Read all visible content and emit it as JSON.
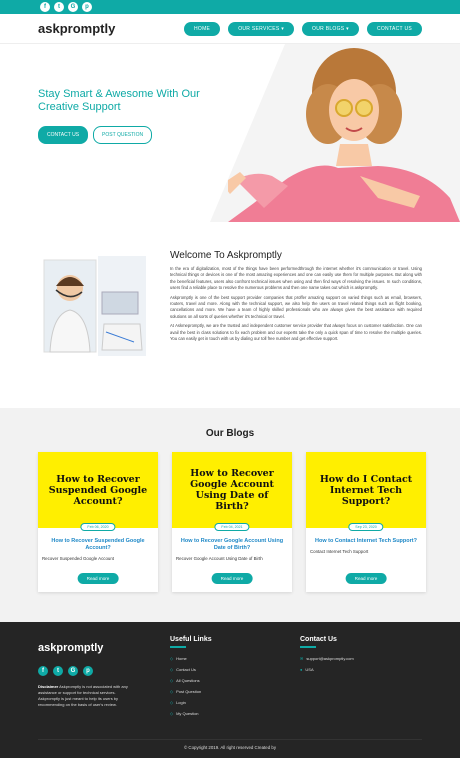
{
  "topbar": {
    "social": [
      "f",
      "t",
      "G",
      "p"
    ]
  },
  "logo": {
    "part1": "ask",
    "part2": "promptly"
  },
  "nav": {
    "home": "HOME",
    "services": "OUR SERVICES",
    "blogs": "OUR BLOGS",
    "contact": "CONTACT US"
  },
  "hero": {
    "title": "Stay Smart & Awesome With Our Creative Support",
    "btn_contact": "CONTACT US",
    "btn_post": "POST QUESTION"
  },
  "welcome": {
    "title": "Welcome To Askpromptly",
    "p1": "In the era of digitalization, most of the things have been performedthrough the internet whether it's communication or travel. Using technical things or devices is one of the most amazing experiences and one can easily use them for multiple purposes. But along with the beneficial features, users also confront technical issues when using and then find ways of resolving the issues. In such conditions, users find a reliable place to resolve the numerous problems and then one name takes out which is askpromptly.",
    "p2": "Askpromptly is one of the best support provider companies that proffer amazing support on varied things such as email, browsers, routers, travel and more. Along with the technical support, we also help the users on travel related things such as flight booking, cancellations and more. We have a team of highly skilled professionals who are always given the best assistance with required solutions on all sorts of queries whether it's technical or travel.",
    "p3": "At Askmepromptly, we are the trusted and independent customer service provider that always focus on customer satisfaction. One can avail the best in class solutions to fix each problem and our experts take the only a quick span of time to resolve the multiple queries. You can easily get in touch with us by dialing our toll free number and get effective support."
  },
  "blogs": {
    "title": "Our Blogs",
    "items": [
      {
        "img_text": "How to Recover Suspended Google Account?",
        "date": "Feb 06, 2020",
        "title": "How to Recover Suspended Google Account?",
        "desc": "Recover Suspended Google Account",
        "btn": "Read more"
      },
      {
        "img_text": "How to Recover Google Account Using Date of Birth?",
        "date": "Feb 04, 2021",
        "title": "How to Recover Google Account Using Date of Birth?",
        "desc": "Recover Google Account Using Date of Birth",
        "btn": "Read more"
      },
      {
        "img_text": "How do I Contact Internet Tech Support?",
        "date": "Sep 23, 2020",
        "title": "How to Contact Internet Tech Support?",
        "desc": "Contact Internet Tech Support",
        "btn": "Read more"
      }
    ]
  },
  "footer": {
    "logo1": "ask",
    "logo2": "promptly",
    "disclaimer_label": "Disclaimer",
    "disclaimer": " Askpromptly is not associated with any assistance or support for technical services. Askpromptly is just meant to help its users by recommending on the basis of user's review.",
    "links_title": "Useful Links",
    "links": [
      "Home",
      "Contact Us",
      "All Questions",
      "Post Question",
      "Login",
      "My Question"
    ],
    "contact_title": "Contact Us",
    "email": "support@askpromptly.com",
    "country": "USA",
    "copyright": "© Copyright 2019. All right reserved Created by"
  }
}
